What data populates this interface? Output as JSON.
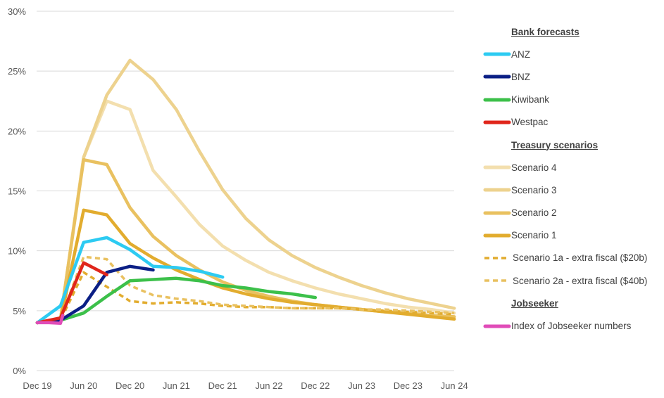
{
  "chart_data": {
    "type": "line",
    "title": "",
    "xlabel": "",
    "ylabel": "",
    "ylim": [
      0,
      30
    ],
    "yticks": [
      "0%",
      "5%",
      "10%",
      "15%",
      "20%",
      "25%",
      "30%"
    ],
    "ytick_values": [
      0,
      5,
      10,
      15,
      20,
      25,
      30
    ],
    "grid": "horizontal",
    "legend_position": "right",
    "x": [
      "Dec 19",
      "Mar 20",
      "Jun 20",
      "Sep 20",
      "Dec 20",
      "Mar 21",
      "Jun 21",
      "Sep 21",
      "Dec 21",
      "Mar 22",
      "Jun 22",
      "Sep 22",
      "Dec 22",
      "Mar 23",
      "Jun 23",
      "Sep 23",
      "Dec 23",
      "Mar 24",
      "Jun 24"
    ],
    "xtick_labels": [
      "Dec 19",
      "Jun 20",
      "Dec 20",
      "Jun 21",
      "Dec 21",
      "Jun 22",
      "Dec 22",
      "Jun 23",
      "Dec 23",
      "Jun 24"
    ],
    "legend_groups": [
      {
        "heading": "Bank forecasts",
        "series": [
          "ANZ",
          "BNZ",
          "Kiwibank",
          "Westpac"
        ]
      },
      {
        "heading": "Treasury scenarios",
        "series": [
          "Scenario 4",
          "Scenario 3",
          "Scenario 2",
          "Scenario 1",
          "Scenario 1a - extra fiscal ($20b)",
          "Scenario 2a - extra fiscal ($40b)"
        ]
      },
      {
        "heading": "Jobseeker",
        "series": [
          "Index of Jobseeker numbers"
        ]
      }
    ],
    "series": [
      {
        "name": "Scenario 4",
        "color": "#F3DFAE",
        "dashed": false,
        "values": [
          4.0,
          4.3,
          17.8,
          22.5,
          21.8,
          16.7,
          14.5,
          12.2,
          10.4,
          9.2,
          8.2,
          7.5,
          6.9,
          6.4,
          6.0,
          5.6,
          5.3,
          5.1,
          4.8
        ]
      },
      {
        "name": "Scenario 3",
        "color": "#EDD28E",
        "dashed": false,
        "values": [
          4.0,
          4.3,
          17.8,
          23.0,
          25.9,
          24.3,
          21.8,
          18.3,
          15.1,
          12.7,
          10.9,
          9.6,
          8.6,
          7.8,
          7.1,
          6.5,
          6.0,
          5.6,
          5.2
        ]
      },
      {
        "name": "Scenario 2",
        "color": "#E9C160",
        "dashed": false,
        "values": [
          4.0,
          4.3,
          17.6,
          17.2,
          13.6,
          11.2,
          9.6,
          8.4,
          7.4,
          6.7,
          6.2,
          5.8,
          5.5,
          5.3,
          5.1,
          4.9,
          4.8,
          4.6,
          4.5
        ]
      },
      {
        "name": "Scenario 1",
        "color": "#E2AC2E",
        "dashed": false,
        "values": [
          4.0,
          4.2,
          13.4,
          13.0,
          10.6,
          9.4,
          8.4,
          7.6,
          6.9,
          6.4,
          6.0,
          5.7,
          5.5,
          5.3,
          5.1,
          4.9,
          4.7,
          4.5,
          4.3
        ]
      },
      {
        "name": "Scenario 1a - extra fiscal ($20b)",
        "color": "#E2AC2E",
        "dashed": true,
        "values": [
          4.0,
          4.2,
          8.2,
          7.0,
          5.8,
          5.6,
          5.7,
          5.6,
          5.4,
          5.3,
          5.3,
          5.2,
          5.2,
          5.2,
          5.1,
          5.0,
          4.9,
          4.8,
          4.7
        ]
      },
      {
        "name": "Scenario 2a - extra fiscal ($40b)",
        "color": "#E9C160",
        "dashed": true,
        "values": [
          4.0,
          4.3,
          9.5,
          9.3,
          7.1,
          6.3,
          6.0,
          5.8,
          5.5,
          5.4,
          5.3,
          5.2,
          5.2,
          5.2,
          5.1,
          5.1,
          5.0,
          4.9,
          4.8
        ]
      },
      {
        "name": "ANZ",
        "color": "#2DCBF2",
        "dashed": false,
        "values": [
          4.0,
          5.4,
          10.7,
          11.1,
          10.1,
          8.7,
          8.6,
          8.3,
          7.8
        ]
      },
      {
        "name": "Kiwibank",
        "color": "#3CC04A",
        "dashed": false,
        "values": [
          4.0,
          4.2,
          4.8,
          6.2,
          7.5,
          7.6,
          7.7,
          7.5,
          7.1,
          6.9,
          6.6,
          6.4,
          6.1
        ]
      },
      {
        "name": "BNZ",
        "color": "#0B1F85",
        "dashed": false,
        "values": [
          4.0,
          4.2,
          5.4,
          8.2,
          8.7,
          8.4
        ]
      },
      {
        "name": "Westpac",
        "color": "#E0261B",
        "dashed": false,
        "values": [
          4.0,
          4.4,
          9.0,
          8.0
        ]
      },
      {
        "name": "Index of Jobseeker numbers",
        "color": "#E04CB8",
        "dashed": false,
        "x_positions": [
          0,
          0.5,
          1.0,
          1.1
        ],
        "values": [
          4.0,
          4.0,
          3.95,
          4.6
        ]
      }
    ]
  }
}
